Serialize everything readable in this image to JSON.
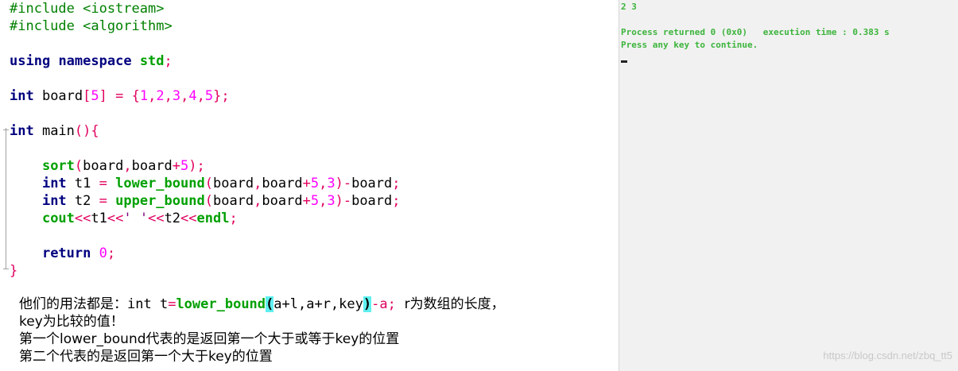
{
  "editor": {
    "lines": [
      [
        {
          "t": "#include <iostream>",
          "c": "pp"
        }
      ],
      [
        {
          "t": "#include <algorithm>",
          "c": "pp"
        }
      ],
      [],
      [
        {
          "t": "using",
          "c": "kw"
        },
        {
          "t": " ",
          "c": "id"
        },
        {
          "t": "namespace",
          "c": "kw"
        },
        {
          "t": " ",
          "c": "id"
        },
        {
          "t": "std",
          "c": "fn"
        },
        {
          "t": ";",
          "c": "op"
        }
      ],
      [],
      [
        {
          "t": "int",
          "c": "kw"
        },
        {
          "t": " board",
          "c": "id"
        },
        {
          "t": "[",
          "c": "op"
        },
        {
          "t": "5",
          "c": "num"
        },
        {
          "t": "]",
          "c": "op"
        },
        {
          "t": " ",
          "c": "id"
        },
        {
          "t": "=",
          "c": "op"
        },
        {
          "t": " ",
          "c": "id"
        },
        {
          "t": "{",
          "c": "op"
        },
        {
          "t": "1",
          "c": "num"
        },
        {
          "t": ",",
          "c": "op"
        },
        {
          "t": "2",
          "c": "num"
        },
        {
          "t": ",",
          "c": "op"
        },
        {
          "t": "3",
          "c": "num"
        },
        {
          "t": ",",
          "c": "op"
        },
        {
          "t": "4",
          "c": "num"
        },
        {
          "t": ",",
          "c": "op"
        },
        {
          "t": "5",
          "c": "num"
        },
        {
          "t": "};",
          "c": "op"
        }
      ],
      [],
      [
        {
          "t": "int",
          "c": "kw"
        },
        {
          "t": " main",
          "c": "id"
        },
        {
          "t": "(){",
          "c": "op"
        }
      ],
      [],
      [
        {
          "t": "    ",
          "c": "id"
        },
        {
          "t": "sort",
          "c": "fn"
        },
        {
          "t": "(",
          "c": "op"
        },
        {
          "t": "board",
          "c": "id"
        },
        {
          "t": ",",
          "c": "op"
        },
        {
          "t": "board",
          "c": "id"
        },
        {
          "t": "+",
          "c": "op"
        },
        {
          "t": "5",
          "c": "num"
        },
        {
          "t": ");",
          "c": "op"
        }
      ],
      [
        {
          "t": "    ",
          "c": "id"
        },
        {
          "t": "int",
          "c": "kw"
        },
        {
          "t": " t1 ",
          "c": "id"
        },
        {
          "t": "=",
          "c": "op"
        },
        {
          "t": " ",
          "c": "id"
        },
        {
          "t": "lower_bound",
          "c": "fn"
        },
        {
          "t": "(",
          "c": "op"
        },
        {
          "t": "board",
          "c": "id"
        },
        {
          "t": ",",
          "c": "op"
        },
        {
          "t": "board",
          "c": "id"
        },
        {
          "t": "+",
          "c": "op"
        },
        {
          "t": "5",
          "c": "num"
        },
        {
          "t": ",",
          "c": "op"
        },
        {
          "t": "3",
          "c": "num"
        },
        {
          "t": ")-",
          "c": "op"
        },
        {
          "t": "board",
          "c": "id"
        },
        {
          "t": ";",
          "c": "op"
        }
      ],
      [
        {
          "t": "    ",
          "c": "id"
        },
        {
          "t": "int",
          "c": "kw"
        },
        {
          "t": " t2 ",
          "c": "id"
        },
        {
          "t": "=",
          "c": "op"
        },
        {
          "t": " ",
          "c": "id"
        },
        {
          "t": "upper_bound",
          "c": "fn"
        },
        {
          "t": "(",
          "c": "op"
        },
        {
          "t": "board",
          "c": "id"
        },
        {
          "t": ",",
          "c": "op"
        },
        {
          "t": "board",
          "c": "id"
        },
        {
          "t": "+",
          "c": "op"
        },
        {
          "t": "5",
          "c": "num"
        },
        {
          "t": ",",
          "c": "op"
        },
        {
          "t": "3",
          "c": "num"
        },
        {
          "t": ")-",
          "c": "op"
        },
        {
          "t": "board",
          "c": "id"
        },
        {
          "t": ";",
          "c": "op"
        }
      ],
      [
        {
          "t": "    ",
          "c": "id"
        },
        {
          "t": "cout",
          "c": "fn"
        },
        {
          "t": "<<",
          "c": "op"
        },
        {
          "t": "t1",
          "c": "id"
        },
        {
          "t": "<<",
          "c": "op"
        },
        {
          "t": "' '",
          "c": "str"
        },
        {
          "t": "<<",
          "c": "op"
        },
        {
          "t": "t2",
          "c": "id"
        },
        {
          "t": "<<",
          "c": "op"
        },
        {
          "t": "endl",
          "c": "fn"
        },
        {
          "t": ";",
          "c": "op"
        }
      ],
      [],
      [
        {
          "t": "    ",
          "c": "id"
        },
        {
          "t": "return",
          "c": "kw"
        },
        {
          "t": " ",
          "c": "id"
        },
        {
          "t": "0",
          "c": "num"
        },
        {
          "t": ";",
          "c": "op"
        }
      ],
      [
        {
          "t": "}",
          "c": "op"
        }
      ]
    ]
  },
  "console": {
    "output_line": "2 3",
    "status_line": "Process returned 0 (0x0)   execution time : 0.383 s",
    "prompt_line": "Press any key to continue."
  },
  "notes": {
    "line1_prefix": "他们的用法都是：",
    "line1_code_a": "int t",
    "line1_code_eq": "=",
    "line1_code_fn": "lower_bound",
    "line1_code_open": "(",
    "line1_code_args": "a+l,a+r,key",
    "line1_code_close": ")",
    "line1_code_tail": "-a;",
    "line1_suffix": "  r为数组的长度，",
    "line2": "key为比较的值！",
    "line3": "第一个lower_bound代表的是返回第一个大于或等于key的位置",
    "line4": "第二个代表的是返回第一个大于key的位置"
  },
  "watermark": "https://blog.csdn.net/zbq_tt5",
  "colors": {
    "console_text": "#3cb43c",
    "highlight": "#5ff0f0"
  }
}
